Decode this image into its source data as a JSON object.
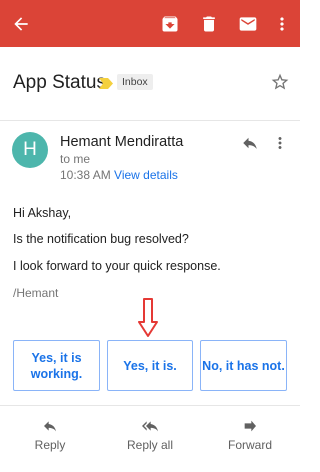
{
  "colors": {
    "app_bar": "#db4437",
    "avatar_bg": "#4db6ac",
    "link": "#1a73e8",
    "annotation_arrow": "#e53935"
  },
  "app_bar": {
    "icons": [
      "back-arrow-icon",
      "archive-icon",
      "delete-icon",
      "mail-icon",
      "more-vert-icon"
    ]
  },
  "email": {
    "subject": "App Status",
    "label": "Inbox",
    "sender": {
      "name": "Hemant Mendiratta",
      "initial": "H"
    },
    "recipient": "to me",
    "time": "10:38 AM",
    "view_details": "View details",
    "body": [
      "Hi Akshay,",
      "Is the notification bug resolved?",
      "I look forward to your quick response."
    ],
    "signature": "/Hemant"
  },
  "smart_replies": [
    "Yes, it is working.",
    "Yes, it is.",
    "No, it has not."
  ],
  "actions": [
    {
      "label": "Reply",
      "icon": "reply-icon"
    },
    {
      "label": "Reply all",
      "icon": "reply-all-icon"
    },
    {
      "label": "Forward",
      "icon": "forward-icon"
    }
  ]
}
